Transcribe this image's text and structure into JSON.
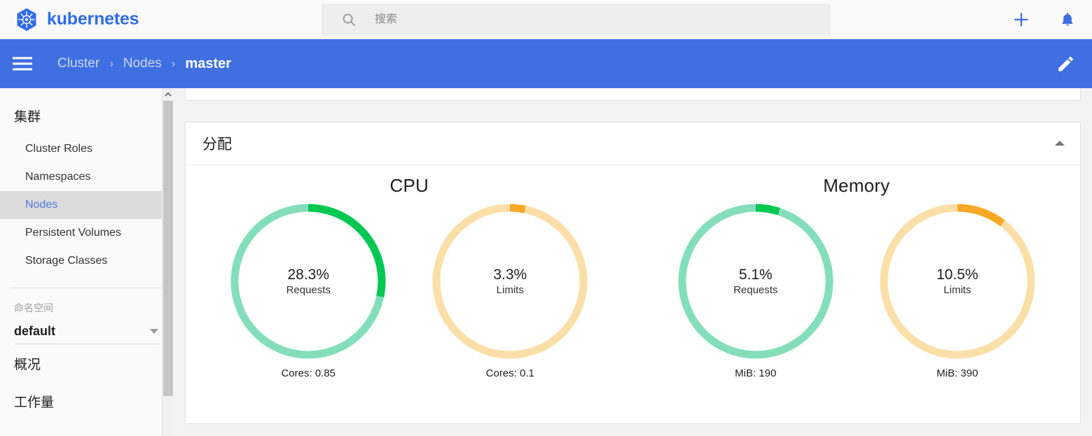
{
  "header": {
    "brand_name": "kubernetes",
    "logo_icon": "kubernetes-helm-icon",
    "search": {
      "icon": "search-icon",
      "placeholder": "搜索",
      "value": ""
    },
    "actions": [
      {
        "name": "create-button",
        "icon": "plus-icon",
        "label": "+"
      },
      {
        "name": "notifications-button",
        "icon": "bell-icon",
        "label": ""
      }
    ],
    "accent_color": "#326ce5"
  },
  "breadcrumb_bar": {
    "menu_icon": "hamburger-menu-icon",
    "edit_icon": "pencil-edit-icon",
    "background_color": "#3f6fe0",
    "crumbs": [
      {
        "label": "Cluster",
        "current": false
      },
      {
        "label": "Nodes",
        "current": false
      },
      {
        "label": "master",
        "current": true
      }
    ],
    "separator": "›"
  },
  "sidebar": {
    "group_title": "集群",
    "items": [
      {
        "label": "Cluster Roles",
        "active": false
      },
      {
        "label": "Namespaces",
        "active": false
      },
      {
        "label": "Nodes",
        "active": true
      },
      {
        "label": "Persistent Volumes",
        "active": false
      },
      {
        "label": "Storage Classes",
        "active": false
      }
    ],
    "namespace": {
      "label": "命名空间",
      "selected": "default",
      "caret_icon": "chevron-down-icon"
    },
    "sections": [
      {
        "label": "概况"
      },
      {
        "label": "工作量"
      }
    ],
    "scrollbar": {
      "up_arrow_icon": "chevron-up-icon"
    }
  },
  "main": {
    "card": {
      "title": "分配",
      "collapse_icon": "chevron-up-icon"
    }
  },
  "chart_data": [
    {
      "type": "pie",
      "title": "CPU",
      "legend": "",
      "slices": [
        {
          "name": "Requests",
          "percent": 28.3,
          "percent_label": "28.3%",
          "sub_label": "Requests",
          "foot_label": "Cores: 0.85",
          "foot_metric": "Cores",
          "foot_value": 0.85,
          "arc_color": "#00c853",
          "track_color": "#85debb"
        },
        {
          "name": "Limits",
          "percent": 3.3,
          "percent_label": "3.3%",
          "sub_label": "Limits",
          "foot_label": "Cores: 0.1",
          "foot_metric": "Cores",
          "foot_value": 0.1,
          "arc_color": "#f9a825",
          "track_color": "#fbdfa8"
        }
      ]
    },
    {
      "type": "pie",
      "title": "Memory",
      "legend": "",
      "slices": [
        {
          "name": "Requests",
          "percent": 5.1,
          "percent_label": "5.1%",
          "sub_label": "Requests",
          "foot_label": "MiB: 190",
          "foot_metric": "MiB",
          "foot_value": 190,
          "arc_color": "#00c853",
          "track_color": "#85debb"
        },
        {
          "name": "Limits",
          "percent": 10.5,
          "percent_label": "10.5%",
          "sub_label": "Limits",
          "foot_label": "MiB: 390",
          "foot_metric": "MiB",
          "foot_value": 390,
          "arc_color": "#f9a825",
          "track_color": "#fbdfa8"
        }
      ]
    }
  ]
}
